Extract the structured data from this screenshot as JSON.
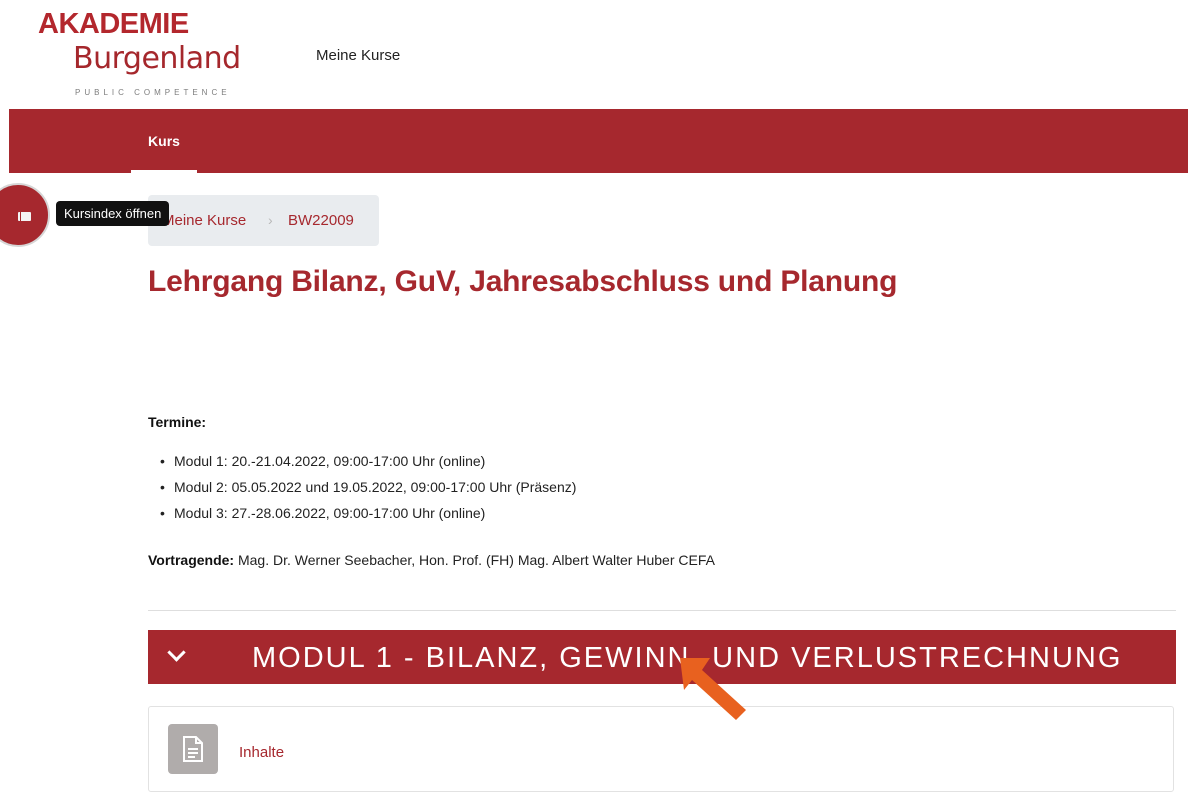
{
  "brand": {
    "line1": "AKADEMIE",
    "line2": "Burgenland",
    "line3": "PUBLIC COMPETENCE"
  },
  "topnav": {
    "my_courses": "Meine Kurse"
  },
  "secondary_nav": {
    "course_tab": "Kurs"
  },
  "drawer": {
    "tooltip": "Kursindex öffnen"
  },
  "breadcrumb": {
    "items": [
      "Meine Kurse",
      "BW22009"
    ],
    "separator": "›"
  },
  "course": {
    "title": "Lehrgang Bilanz, GuV, Jahresabschluss und Planung",
    "dates_label": "Termine:",
    "dates": [
      "Modul 1: 20.-21.04.2022, 09:00-17:00 Uhr (online)",
      "Modul 2: 05.05.2022 und 19.05.2022, 09:00-17:00 Uhr (Präsenz)",
      "Modul 3: 27.-28.06.2022, 09:00-17:00 Uhr (online)"
    ],
    "speakers_label": "Vortragende:",
    "speakers": " Mag. Dr. Werner Seebacher, Hon. Prof. (FH) Mag. Albert Walter Huber CEFA"
  },
  "section": {
    "title": "MODUL 1 - BILANZ, GEWINN- UND VERLUSTRECHNUNG"
  },
  "activity": {
    "label": "Inhalte",
    "icon": "file-icon"
  },
  "colors": {
    "brand_red": "#a6282e",
    "annotation_orange": "#e8611f"
  }
}
